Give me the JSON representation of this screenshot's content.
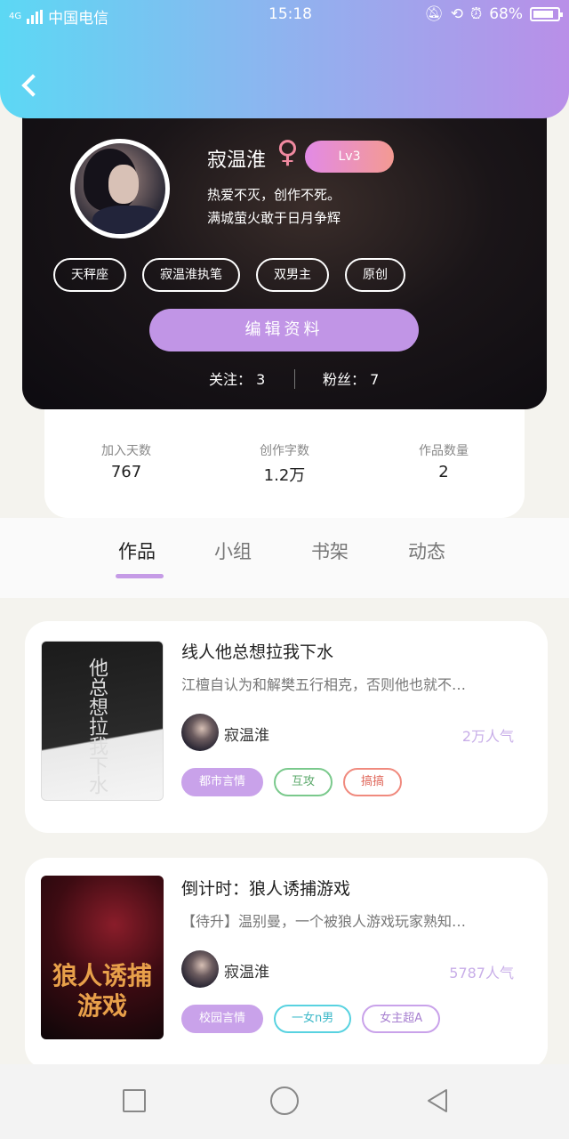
{
  "status_bar": {
    "carrier": "中国电信",
    "network": "4G",
    "time": "15:18",
    "battery": "68%"
  },
  "profile": {
    "name": "寂温淮",
    "gender_icon": "♀",
    "level": "Lv3",
    "bio_line1": "热爱不灭，创作不死。",
    "bio_line2": "满城萤火敢于日月争辉",
    "tags": [
      "天秤座",
      "寂温淮执笔",
      "双男主",
      "原创"
    ],
    "edit_button": "编辑资料",
    "follow_label": "关注： 3",
    "fans_label": "粉丝： 7"
  },
  "stats": [
    {
      "label": "加入天数",
      "value": "767"
    },
    {
      "label": "创作字数",
      "value": "1.2万"
    },
    {
      "label": "作品数量",
      "value": "2"
    }
  ],
  "tabs": [
    "作品",
    "小组",
    "书架",
    "动态"
  ],
  "active_tab": 0,
  "books": [
    {
      "title": "线人他总想拉我下水",
      "desc": "江檀自认为和解樊五行相克，否则他也就不…",
      "author": "寂温淮",
      "popularity": "2万人气",
      "tags": [
        {
          "text": "都市言情",
          "color": "#c9a2ea"
        },
        {
          "text": "互攻",
          "color": "#7ac98c"
        },
        {
          "text": "搞搞",
          "color": "#f08a7e"
        }
      ],
      "cover_text": "他总想拉我下水"
    },
    {
      "title": "倒计时：狼人诱捕游戏",
      "desc": "【待升】温别曼，一个被狼人游戏玩家熟知…",
      "author": "寂温淮",
      "popularity": "5787人气",
      "tags": [
        {
          "text": "校园言情",
          "color": "#c9a2ea"
        },
        {
          "text": "一女n男",
          "color": "#58d2e0"
        },
        {
          "text": "女主超A",
          "color": "#c9a2ea"
        }
      ],
      "cover_text": "狼人诱捕游戏"
    }
  ]
}
